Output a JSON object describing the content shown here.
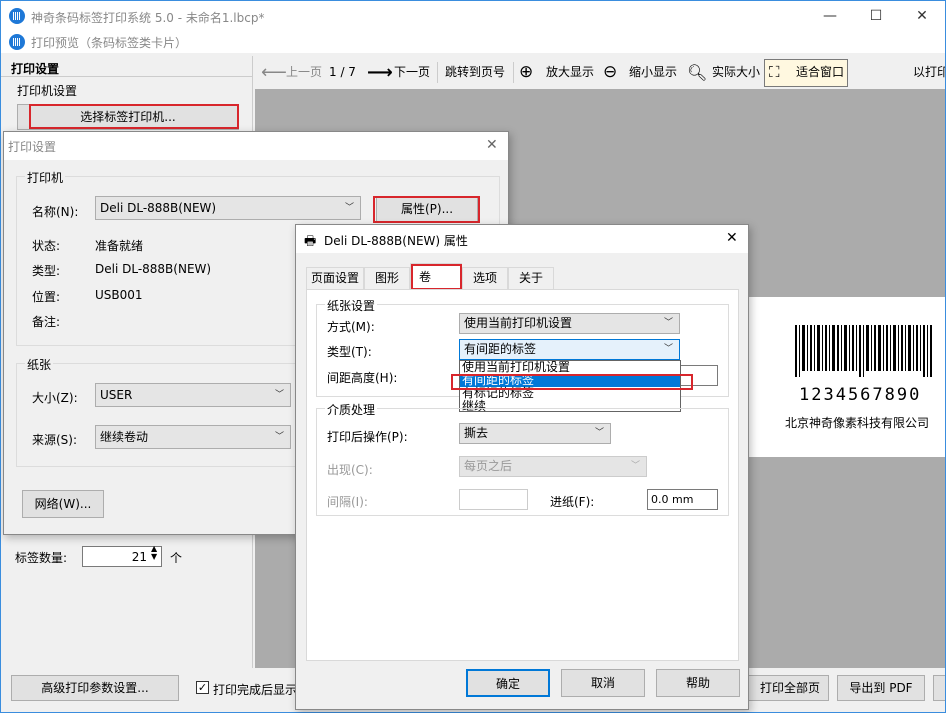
{
  "app": {
    "title": "神奇条码标签打印系统 5.0 - 未命名1.lbcp*",
    "min": "—",
    "max": "☐",
    "close": "✕"
  },
  "preview": {
    "title": "打印预览（条码标签类卡片）"
  },
  "left": {
    "section": "打印设置",
    "printer_group": "打印机设置",
    "select_printer": "选择标签打印机...",
    "label_count_label": "标签数量:",
    "label_count_value": "21",
    "label_count_unit": "个"
  },
  "toolbar": {
    "prev": "上一页",
    "page": "1 / 7",
    "next": "下一页",
    "goto": "跳转到页号",
    "zoom_in": "放大显示",
    "zoom_out": "缩小显示",
    "actual": "实际大小",
    "fit": "适合窗口",
    "print_cut": "以打印"
  },
  "label": {
    "digits": "1234567890",
    "company": "北京神奇像素科技有限公司"
  },
  "bottom": {
    "advanced": "高级打印参数设置...",
    "auto_close": "打印完成后显示",
    "print_all": "打印全部页",
    "export_pdf": "导出到 PDF"
  },
  "print_dialog": {
    "title": "打印设置",
    "close": "✕",
    "printer_group": "打印机",
    "name_label": "名称(N):",
    "name_value": "Deli DL-888B(NEW)",
    "properties": "属性(P)...",
    "status_label": "状态:",
    "status_value": "准备就绪",
    "type_label": "类型:",
    "type_value": "Deli DL-888B(NEW)",
    "location_label": "位置:",
    "location_value": "USB001",
    "comment_label": "备注:",
    "paper_group": "纸张",
    "size_label": "大小(Z):",
    "size_value": "USER",
    "source_label": "来源(S):",
    "source_value": "继续卷动",
    "network": "网络(W)..."
  },
  "props_dialog": {
    "title": "Deli DL-888B(NEW) 属性",
    "close": "✕",
    "tabs": [
      "页面设置",
      "图形",
      "卷",
      "选项",
      "关于"
    ],
    "paper_group": "纸张设置",
    "method_label": "方式(M):",
    "method_value": "使用当前打印机设置",
    "type_label": "类型(T):",
    "type_value": "有间距的标签",
    "gap_label": "间距高度(H):",
    "dropdown_options": [
      "使用当前打印机设置",
      "有间距的标签",
      "有标记的标签",
      "继续"
    ],
    "media_group": "介质处理",
    "after_label": "打印后操作(P):",
    "after_value": "撕去",
    "appear_label": "出现(C):",
    "appear_value": "每页之后",
    "interval_label": "间隔(I):",
    "feed_label": "进纸(F):",
    "feed_value": "0.0 mm",
    "ok": "确定",
    "cancel": "取消",
    "help": "帮助"
  },
  "colors": {
    "highlight": "#0078d7",
    "red_annotation": "#d8262c"
  }
}
